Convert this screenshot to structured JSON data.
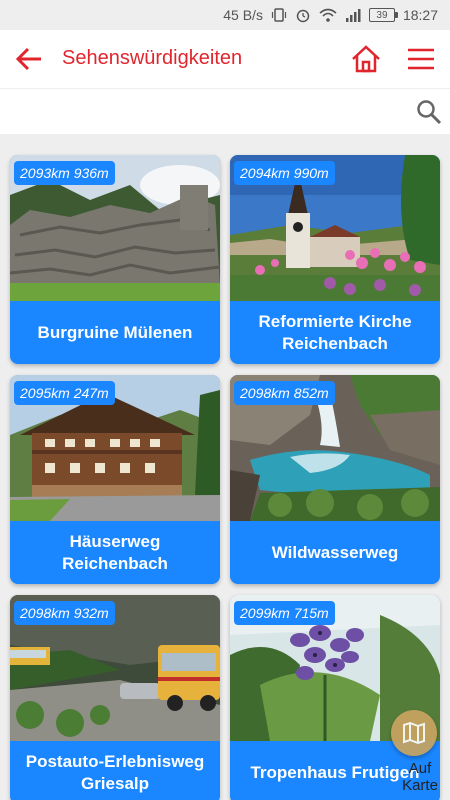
{
  "status_bar": {
    "network_speed": "45 B/s",
    "battery": "39",
    "time": "18:27"
  },
  "header": {
    "title": "Sehenswürdigkeiten"
  },
  "search": {
    "value": "",
    "placeholder": ""
  },
  "cards": [
    {
      "distance": "2093km 936m",
      "title": "Burgruine Mülenen"
    },
    {
      "distance": "2094km 990m",
      "title": "Reformierte Kirche Reichenbach"
    },
    {
      "distance": "2095km 247m",
      "title": "Häuserweg Reichenbach"
    },
    {
      "distance": "2098km 852m",
      "title": "Wildwasserweg"
    },
    {
      "distance": "2098km 932m",
      "title": "Postauto-Erlebnisweg Griesalp"
    },
    {
      "distance": "2099km 715m",
      "title": "Tropenhaus Frutigen"
    }
  ],
  "map_button": {
    "label": "Auf Karte"
  },
  "colors": {
    "accent_red": "#e0252d",
    "card_blue": "#1a86ff",
    "map_gold": "#c8a460"
  }
}
